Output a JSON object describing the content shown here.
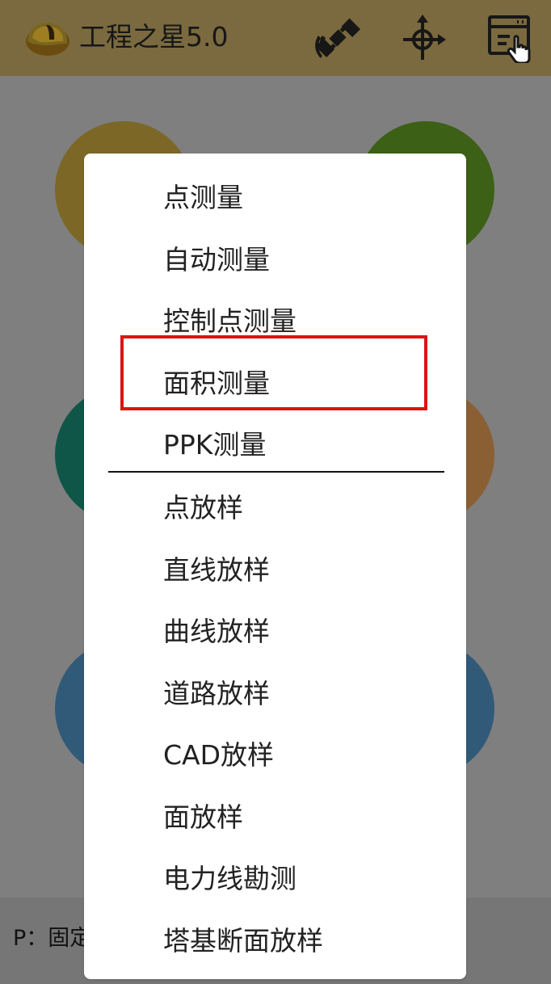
{
  "app": {
    "title": "工程之星5.0"
  },
  "toolbar": {
    "icons": [
      {
        "name": "satellite-icon"
      },
      {
        "name": "crosshair-icon"
      },
      {
        "name": "window-pointer-icon"
      }
    ]
  },
  "home": {
    "tiles": [
      {
        "name": "home-tile-orange",
        "color": "#7c6727"
      },
      {
        "name": "home-tile-green",
        "color": "#3d6017"
      },
      {
        "name": "home-tile-teal",
        "color": "#0f5648"
      },
      {
        "name": "home-tile-brown",
        "color": "#8a5f34"
      },
      {
        "name": "home-tile-blue-left",
        "color": "#315a79"
      },
      {
        "name": "home-tile-blue-right",
        "color": "#315a79"
      }
    ]
  },
  "status": {
    "text": "P：固定"
  },
  "menu": {
    "items": [
      {
        "label": "点测量"
      },
      {
        "label": "自动测量"
      },
      {
        "label": "控制点测量"
      },
      {
        "label": "面积测量"
      },
      {
        "label": "PPK测量"
      },
      {
        "label": "点放样"
      },
      {
        "label": "直线放样"
      },
      {
        "label": "曲线放样"
      },
      {
        "label": "道路放样"
      },
      {
        "label": "CAD放样"
      },
      {
        "label": "面放样"
      },
      {
        "label": "电力线勘测"
      },
      {
        "label": "塔基断面放样"
      }
    ]
  },
  "highlight": {
    "color": "#dd1414"
  }
}
